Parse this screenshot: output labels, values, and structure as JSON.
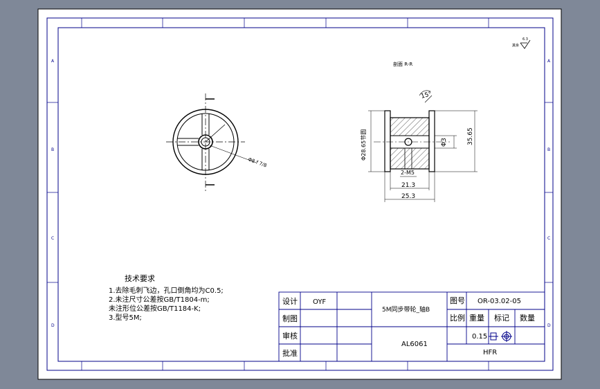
{
  "drawing": {
    "section_title": "剖面 R-R",
    "roughness": "6.3",
    "roughness_prefix": "其余",
    "border_marks": {
      "left": [
        "A",
        "B",
        "C",
        "D"
      ],
      "right": [
        "A",
        "B",
        "C",
        "D"
      ]
    },
    "front_view": {
      "callout": "Φ8 f 7/8"
    },
    "section_view": {
      "angle": "15°",
      "pitch_diameter": "Φ28.65节圆",
      "bore": "Φ3",
      "height": "35.65",
      "thread": "2-M5",
      "width_inner": "21.3",
      "width_outer": "25.3"
    }
  },
  "technical_requirements": {
    "heading": "技术要求",
    "lines": [
      "1.去除毛刺飞边，孔口倒角均为C0.5;",
      "2.未注尺寸公差按GB/T1804-m;",
      "  未注形位公差按GB/T1184-K;",
      "3.型号5M;"
    ]
  },
  "title_block": {
    "designer_label": "设计",
    "designer_value": "OYF",
    "drawing_label": "制图",
    "review_label": "审核",
    "approve_label": "批准",
    "part_name": "5M同步带轮_轴B",
    "material": "AL6061",
    "drawing_no_label": "图号",
    "drawing_no_value": "OR-03.02-05",
    "scale_label": "比例",
    "weight_label": "重量",
    "mark_label": "标记",
    "qty_label": "数量",
    "weight_value": "0.15",
    "company": "HFR"
  }
}
